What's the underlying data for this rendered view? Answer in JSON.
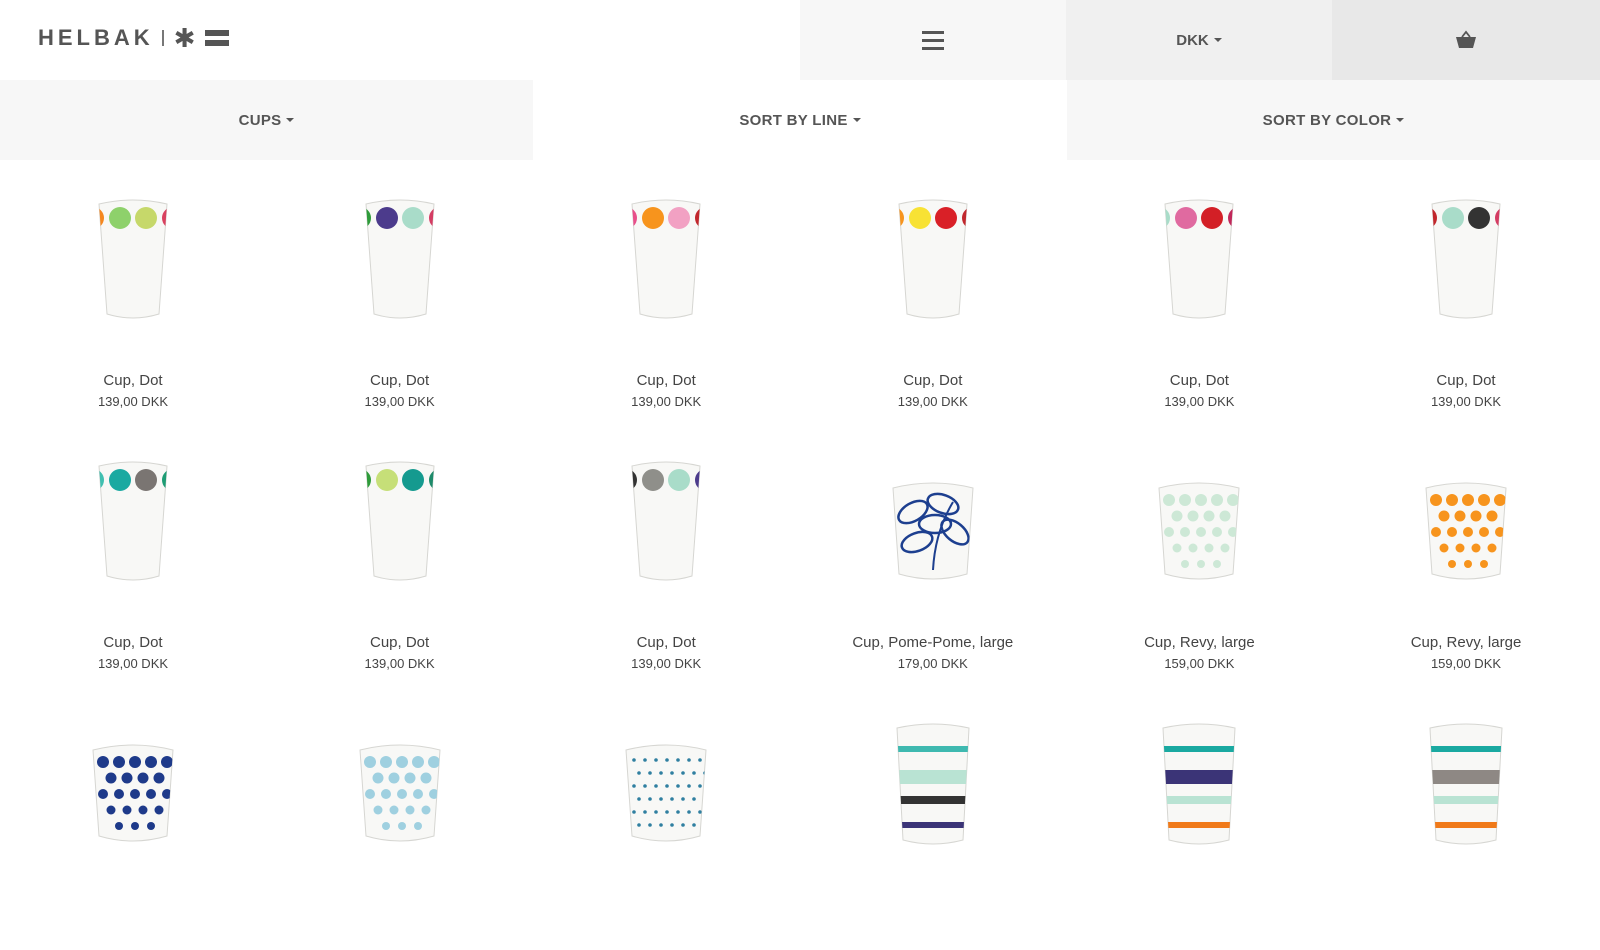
{
  "header": {
    "brand": "HELBAK",
    "currency": "DKK",
    "icons": {
      "menu": "hamburger-menu-icon",
      "cart": "shopping-basket-icon"
    }
  },
  "filters": {
    "category": "CUPS",
    "sort_line": "SORT BY LINE",
    "sort_color": "SORT BY COLOR"
  },
  "products": [
    {
      "name": "Cup, Dot",
      "price": "139,00 DKK",
      "dots": [
        "#f5871f",
        "#8ed16b",
        "#c6d86a",
        "#d9415f"
      ]
    },
    {
      "name": "Cup, Dot",
      "price": "139,00 DKK",
      "dots": [
        "#2e9b3a",
        "#4c3b8c",
        "#a9dcc9",
        "#d43c63"
      ]
    },
    {
      "name": "Cup, Dot",
      "price": "139,00 DKK",
      "dots": [
        "#e84f8a",
        "#f7941d",
        "#f2a1c3",
        "#c1272d"
      ]
    },
    {
      "name": "Cup, Dot",
      "price": "139,00 DKK",
      "dots": [
        "#f7941d",
        "#f8e234",
        "#d92027",
        "#c1272d"
      ]
    },
    {
      "name": "Cup, Dot",
      "price": "139,00 DKK",
      "dots": [
        "#a9dcc9",
        "#e06aa0",
        "#d31f26",
        "#c1275a"
      ]
    },
    {
      "name": "Cup, Dot",
      "price": "139,00 DKK",
      "dots": [
        "#c1272d",
        "#a9dcc9",
        "#333333",
        "#d43c63"
      ]
    },
    {
      "name": "Cup, Dot",
      "price": "139,00 DKK",
      "dots": [
        "#3fbfb0",
        "#1aa9a1",
        "#7a7572",
        "#1d9c74"
      ]
    },
    {
      "name": "Cup, Dot",
      "price": "139,00 DKK",
      "dots": [
        "#2e9b3a",
        "#c6df78",
        "#159a8f",
        "#1d8a6a"
      ]
    },
    {
      "name": "Cup, Dot",
      "price": "139,00 DKK",
      "dots": [
        "#333333",
        "#8f8f8a",
        "#a9dcc9",
        "#4c3b8c"
      ]
    },
    {
      "name": "Cup, Pome-Pome, large",
      "price": "179,00 DKK",
      "style": "leaf",
      "colors": [
        "#1d3f8f"
      ]
    },
    {
      "name": "Cup, Revy, large",
      "price": "159,00 DKK",
      "style": "polka",
      "colors": [
        "#cde8d6"
      ]
    },
    {
      "name": "Cup, Revy, large",
      "price": "159,00 DKK",
      "style": "polka",
      "colors": [
        "#f7941d"
      ]
    },
    {
      "name": "",
      "price": "",
      "style": "polka",
      "colors": [
        "#1e3a8a"
      ]
    },
    {
      "name": "",
      "price": "",
      "style": "polka",
      "colors": [
        "#9fd0e0"
      ]
    },
    {
      "name": "",
      "price": "",
      "style": "tinydots",
      "colors": [
        "#2f7fa0"
      ]
    },
    {
      "name": "",
      "price": "",
      "style": "stripes",
      "colors": [
        "#3fb9b0",
        "#b9e3d3",
        "#333333",
        "#3b3477"
      ]
    },
    {
      "name": "",
      "price": "",
      "style": "stripes",
      "colors": [
        "#1aa9a1",
        "#3b3477",
        "#b9e3d3",
        "#f07a1a"
      ]
    },
    {
      "name": "",
      "price": "",
      "style": "stripes",
      "colors": [
        "#1aa9a1",
        "#8e8884",
        "#b9e3d3",
        "#f07a1a"
      ]
    }
  ]
}
